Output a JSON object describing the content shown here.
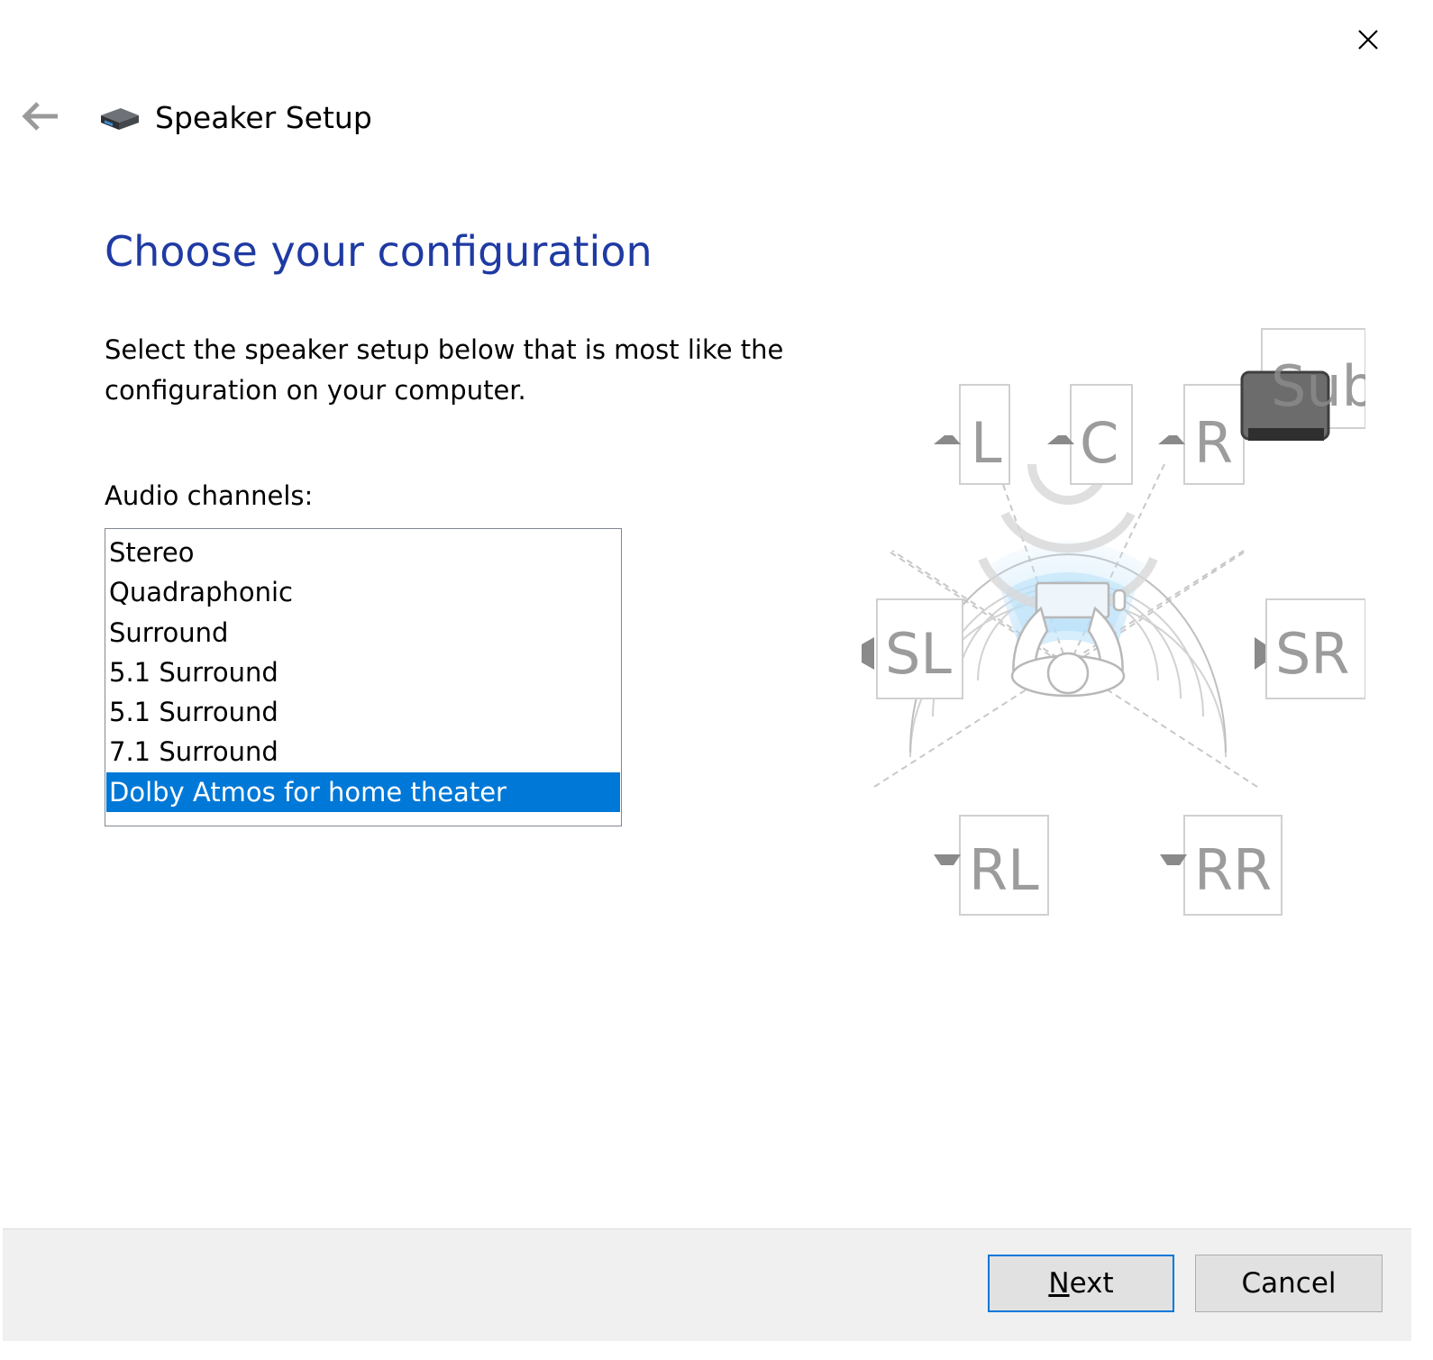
{
  "window": {
    "title": "Speaker Setup",
    "close_icon": "close-icon",
    "back_icon": "back-arrow-icon",
    "app_icon": "speaker-icon"
  },
  "page": {
    "heading": "Choose your configuration",
    "instructions": "Select the speaker setup below that is most like the configuration on your computer.",
    "channels_label": "Audio channels:"
  },
  "channels": {
    "items": [
      "Stereo",
      "Quadraphonic",
      "Surround",
      "5.1 Surround",
      "5.1 Surround",
      "7.1 Surround",
      "Dolby Atmos for home theater"
    ],
    "selected_index": 6
  },
  "diagram": {
    "speakers": {
      "left": "L",
      "center": "C",
      "right": "R",
      "subwoofer": "Sub",
      "side_left": "SL",
      "side_right": "SR",
      "rear_left": "RL",
      "rear_right": "RR"
    }
  },
  "footer": {
    "next_access_key": "N",
    "next_rest": "ext",
    "cancel_label": "Cancel"
  },
  "colors": {
    "heading": "#1f3aa3",
    "selection": "#0078d7",
    "footer_bg": "#f0f0f0"
  }
}
